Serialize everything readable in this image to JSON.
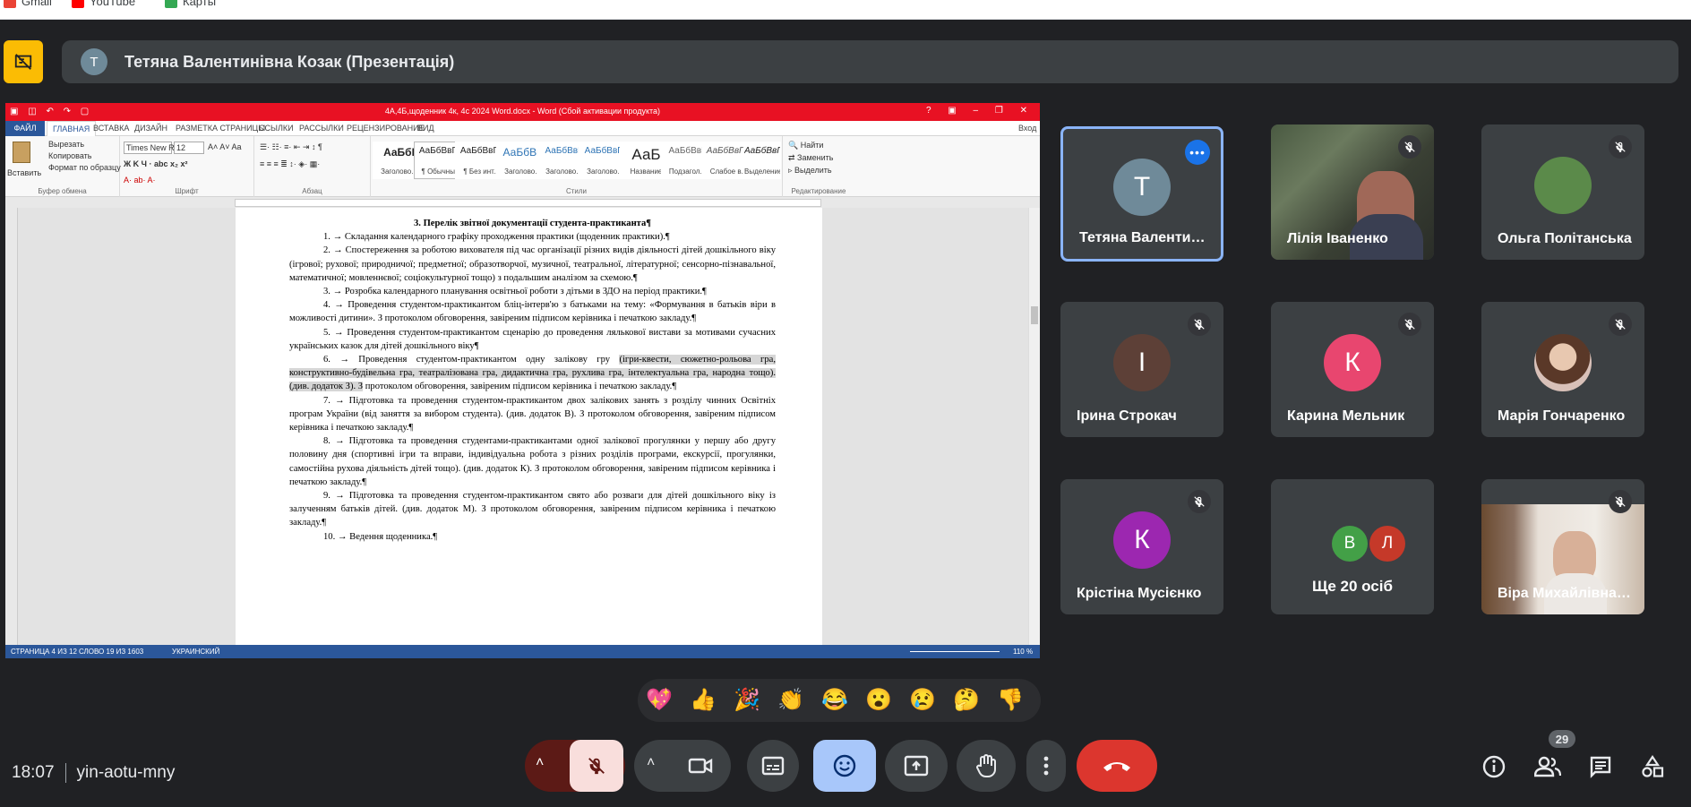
{
  "bookmarks": [
    {
      "label": "Gmail",
      "color": "#ea4335"
    },
    {
      "label": "YouTube",
      "color": "#ff0000"
    },
    {
      "label": "Карты",
      "color": "#34a853"
    }
  ],
  "presentation": {
    "avatar_letter": "T",
    "presenter_label": "Тетяна Валентинівна Козак (Презентація)"
  },
  "word": {
    "title": "4А,4Б,щоденник 4к, 4с  2024 Word.docx -  Word (Сбой активации продукта)",
    "tabs": [
      "ФАЙЛ",
      "ГЛАВНАЯ",
      "ВСТАВКА",
      "ДИЗАЙН",
      "РАЗМЕТКА СТРАНИЦЫ",
      "ССЫЛКИ",
      "РАССЫЛКИ",
      "РЕЦЕНЗИРОВАНИЕ",
      "ВИД"
    ],
    "signin": "Вход",
    "clipboard": {
      "paste": "Вставить",
      "cut": "Вырезать",
      "copy": "Копировать",
      "format": "Формат по образцу",
      "group": "Буфер обмена"
    },
    "font": {
      "name": "Times New R",
      "size": "12",
      "group": "Шрифт"
    },
    "paragraph_group": "Абзац",
    "styles_group": "Стили",
    "styles": [
      {
        "preview": "АаБбI",
        "name": "Заголово..."
      },
      {
        "preview": "АаБбВвГг,",
        "name": "¶ Обычный"
      },
      {
        "preview": "АаБбВвГг,",
        "name": "¶ Без инт..."
      },
      {
        "preview": "АаБбВв",
        "name": "Заголово..."
      },
      {
        "preview": "АаБбВвГ",
        "name": "Заголово..."
      },
      {
        "preview": "АаБбВвГг",
        "name": "Заголово..."
      },
      {
        "preview": "АаБ",
        "name": "Название"
      },
      {
        "preview": "АаБбВвГ",
        "name": "Подзагол..."
      },
      {
        "preview": "АаБбВвГг,",
        "name": "Слабое в..."
      },
      {
        "preview": "АаБбВвГг,",
        "name": "Выделение"
      }
    ],
    "editing": {
      "find": "Найти",
      "replace": "Заменить",
      "select": "Выделить",
      "group": "Редактирование"
    },
    "doc_heading": "3. Перелік звітної документації студента-практиканта¶",
    "doc_paras": [
      "1.  →  Складання календарного графіку проходження практики (щоденник практики).¶",
      "2.  →  Спостереження за роботою вихователя під час організації різних видів діяльності дітей дошкільного віку (ігрової; рухової; природничої; предметної; образотворчої, музичної, театральної, літературної; сенсорно-пізнавальної, математичної; мовленнєвої; соціокультурної тощо) з подальшим аналізом за схемою.¶",
      "3.  →  Розробка календарного планування освітньої роботи з дітьми в ЗДО на період практики.¶",
      "4.  →  Проведення студентом-практикантом бліц-інтерв'ю з батьками на тему: «Формування в батьків віри в можливості дитини». З протоколом обговорення, завіреним підписом керівника і печаткою закладу.¶",
      "5.  →  Проведення студентом-практикантом сценарію до проведення лялькової вистави за мотивами сучасних українських казок для дітей дошкільного віку¶"
    ],
    "doc_p6_start": "6.  →  Проведення студентом-практикантом одну залікову гру ",
    "doc_p6_highlight": "(ігри-квести, сюжетно-рольова гра, конструктивно-будівельна гра, театралізована гра, дидактична гра, рухлива гра, інтелектуальна гра, народна тощо). (див. додаток З). З",
    "doc_p6_end": " протоколом обговорення, завіреним підписом керівника і печаткою закладу.¶",
    "doc_paras2": [
      "7.  →  Підготовка та проведення студентом-практикантом двох залікових занять з розділу чинних Освітніх програм України (від заняття за вибором студента). (див. додаток В). З протоколом обговорення, завіреним підписом керівника і печаткою закладу.¶",
      "8.  →  Підготовка та проведення студентами-практикантами одної залікової прогулянки у першу або другу половину дня (спортивні ігри та вправи, індивідуальна робота з різних розділів програми, екскурсії, прогулянки, самостійна рухова діяльність дітей тощо). (див. додаток К). З протоколом обговорення, завіреним підписом керівника і печаткою закладу.¶",
      "9.  →  Підготовка та проведення студентом-практикантом свято або розваги для дітей дошкільного віку із залученням батьків дітей. (див. додаток М). З протоколом обговорення, завіреним підписом керівника і печаткою закладу.¶",
      "10.  →  Ведення щоденника.¶"
    ],
    "status_page": "СТРАНИЦА 4 ИЗ 12",
    "status_words": "СЛОВО 19 ИЗ 1603",
    "status_lang": "УКРАИНСКИЙ",
    "zoom": "110 %"
  },
  "participants": [
    {
      "name": "Тетяна Валентинів...",
      "letter": "T",
      "color": "#6f8a99",
      "type": "avatar",
      "highlight": true
    },
    {
      "name": "Лілія Іваненко",
      "type": "video"
    },
    {
      "name": "Ольга Політанська",
      "type": "photo",
      "color": "#5b8a4a"
    },
    {
      "name": "Ірина Строкач",
      "letter": "І",
      "color": "#5d4037",
      "type": "avatar"
    },
    {
      "name": "Карина Мельник",
      "letter": "К",
      "color": "#e8466f",
      "type": "avatar"
    },
    {
      "name": "Марія Гончаренко",
      "type": "photo",
      "color": "#b08070"
    },
    {
      "name": "Крістіна Мусієнко",
      "letter": "К",
      "color": "#9c27b0",
      "type": "avatar"
    },
    {
      "name": "Ще 20 осіб",
      "type": "more",
      "letters": [
        "В",
        "Л"
      ],
      "colors": [
        "#43a047",
        "#c53929"
      ]
    },
    {
      "name": "Віра Михайлівна К...",
      "type": "video2"
    }
  ],
  "reactions": [
    "💖",
    "👍",
    "🎉",
    "👏",
    "😂",
    "😮",
    "😢",
    "🤔",
    "👎"
  ],
  "meeting": {
    "time": "18:07",
    "code": "yin-aotu-mny",
    "participant_count": "29"
  }
}
